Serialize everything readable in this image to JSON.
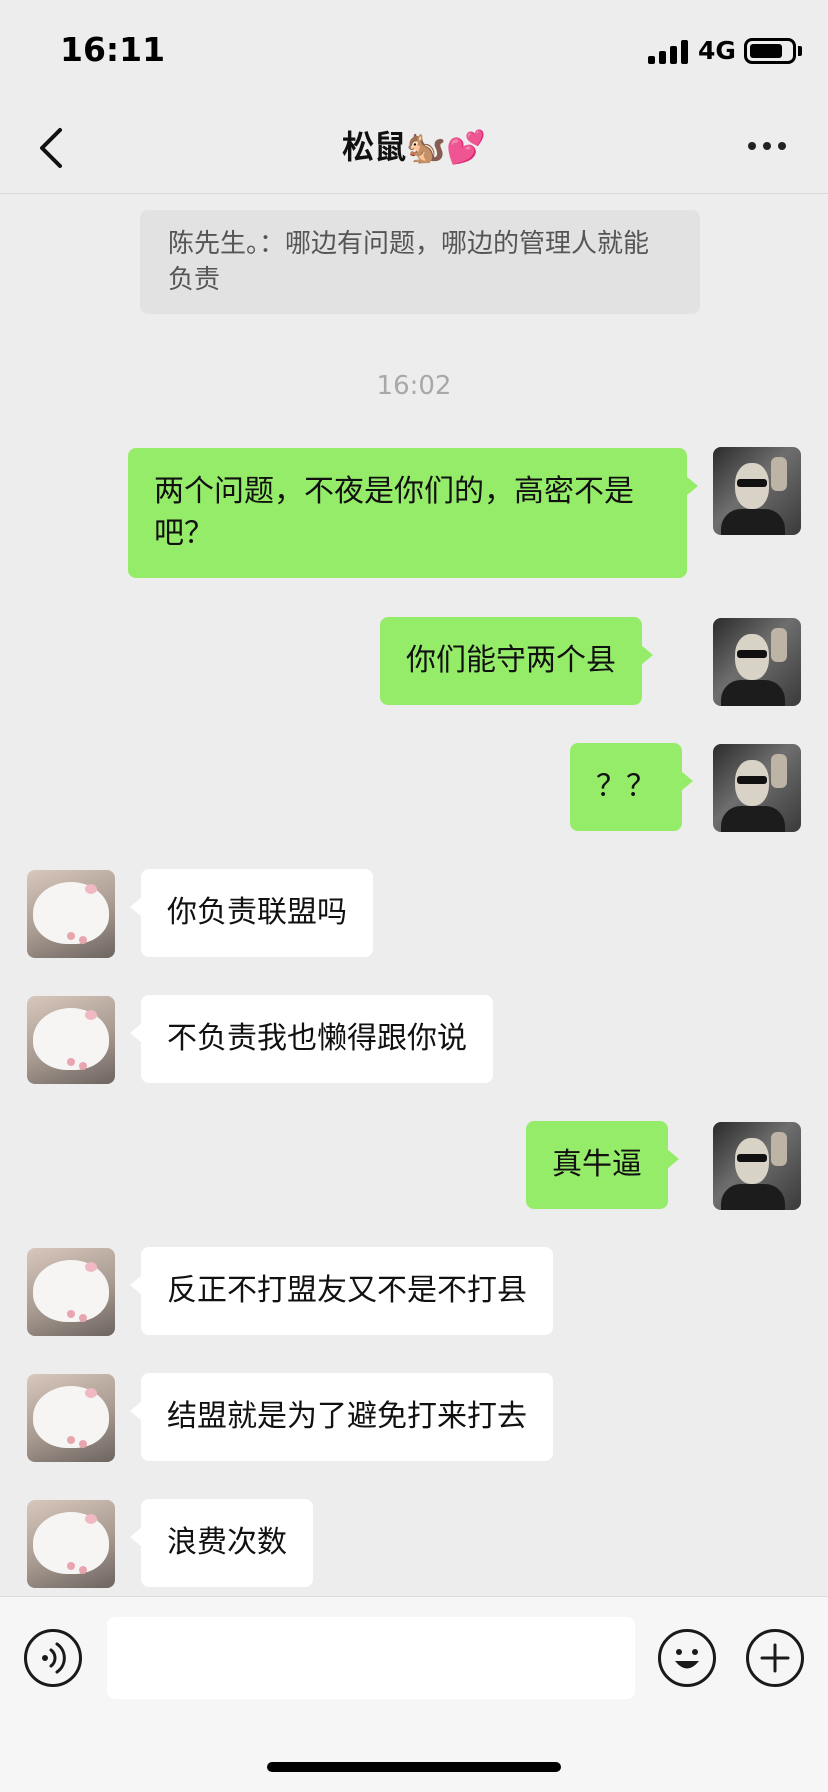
{
  "status_bar": {
    "time": "16:11",
    "network": "4G"
  },
  "header": {
    "title": "松鼠🐿️💕"
  },
  "chat": {
    "quote_text": "陈先生。：哪边有问题，哪边的管理人就能负责",
    "timestamp": "16:02",
    "messages": [
      {
        "sender": "me",
        "text": "两个问题，不夜是你们的，高密不是吧？"
      },
      {
        "sender": "me",
        "text": "你们能守两个县"
      },
      {
        "sender": "me",
        "text": "？？"
      },
      {
        "sender": "other",
        "text": "你负责联盟吗"
      },
      {
        "sender": "other",
        "text": "不负责我也懒得跟你说"
      },
      {
        "sender": "me",
        "text": "真牛逼"
      },
      {
        "sender": "other",
        "text": "反正不打盟友又不是不打县"
      },
      {
        "sender": "other",
        "text": "结盟就是为了避免打来打去"
      },
      {
        "sender": "other",
        "text": "浪费次数"
      }
    ]
  },
  "input_bar": {
    "value": ""
  },
  "colors": {
    "background": "#ededed",
    "my_bubble": "#95ec69",
    "other_bubble": "#ffffff"
  },
  "icons": {
    "back": "chevron-left-icon",
    "more": "more-icon",
    "voice": "voice-icon",
    "emoji": "emoji-icon",
    "plus": "plus-icon"
  }
}
